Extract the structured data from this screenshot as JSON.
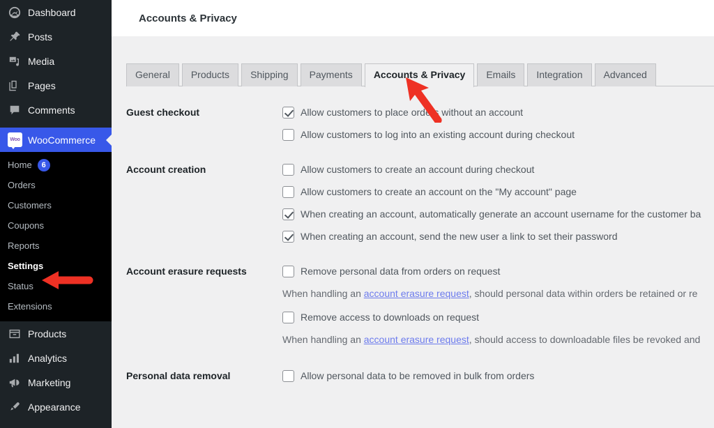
{
  "header": {
    "title": "Accounts & Privacy"
  },
  "sidebar": {
    "top_items": [
      {
        "label": "Dashboard",
        "icon": "dashboard-icon",
        "current": false
      },
      {
        "label": "Posts",
        "icon": "pin-icon",
        "current": false
      },
      {
        "label": "Media",
        "icon": "media-icon",
        "current": false
      },
      {
        "label": "Pages",
        "icon": "pages-icon",
        "current": false
      },
      {
        "label": "Comments",
        "icon": "comments-icon",
        "current": false
      }
    ],
    "woocommerce": {
      "label": "WooCommerce",
      "icon": "woocommerce-icon",
      "current": true
    },
    "submenu": [
      {
        "label": "Home",
        "count": "6",
        "current": false
      },
      {
        "label": "Orders",
        "count": "",
        "current": false
      },
      {
        "label": "Customers",
        "count": "",
        "current": false
      },
      {
        "label": "Coupons",
        "count": "",
        "current": false
      },
      {
        "label": "Reports",
        "count": "",
        "current": false
      },
      {
        "label": "Settings",
        "count": "",
        "current": true
      },
      {
        "label": "Status",
        "count": "",
        "current": false
      },
      {
        "label": "Extensions",
        "count": "",
        "current": false
      }
    ],
    "bottom_items": [
      {
        "label": "Products",
        "icon": "products-icon",
        "current": false
      },
      {
        "label": "Analytics",
        "icon": "analytics-icon",
        "current": false
      },
      {
        "label": "Marketing",
        "icon": "marketing-icon",
        "current": false
      },
      {
        "label": "Appearance",
        "icon": "appearance-icon",
        "current": false
      }
    ]
  },
  "tabs": [
    {
      "label": "General",
      "active": false
    },
    {
      "label": "Products",
      "active": false
    },
    {
      "label": "Shipping",
      "active": false
    },
    {
      "label": "Payments",
      "active": false
    },
    {
      "label": "Accounts & Privacy",
      "active": true
    },
    {
      "label": "Emails",
      "active": false
    },
    {
      "label": "Integration",
      "active": false
    },
    {
      "label": "Advanced",
      "active": false
    }
  ],
  "settings": {
    "guest_checkout": {
      "label": "Guest checkout",
      "options": [
        {
          "label": "Allow customers to place orders without an account",
          "checked": true
        },
        {
          "label": "Allow customers to log into an existing account during checkout",
          "checked": false
        }
      ]
    },
    "account_creation": {
      "label": "Account creation",
      "options": [
        {
          "label": "Allow customers to create an account during checkout",
          "checked": false
        },
        {
          "label": "Allow customers to create an account on the \"My account\" page",
          "checked": false
        },
        {
          "label": "When creating an account, automatically generate an account username for the customer ba",
          "checked": true
        },
        {
          "label": "When creating an account, send the new user a link to set their password",
          "checked": true
        }
      ]
    },
    "account_erasure": {
      "label": "Account erasure requests",
      "option1": {
        "label": "Remove personal data from orders on request",
        "checked": false
      },
      "desc1_before": "When handling an ",
      "desc1_link": "account erasure request",
      "desc1_after": ", should personal data within orders be retained or re",
      "option2": {
        "label": "Remove access to downloads on request",
        "checked": false
      },
      "desc2_before": "When handling an ",
      "desc2_link": "account erasure request",
      "desc2_after": ", should access to downloadable files be revoked and"
    },
    "personal_data_removal": {
      "label": "Personal data removal",
      "options": [
        {
          "label": "Allow personal data to be removed in bulk from orders",
          "checked": false
        }
      ]
    }
  },
  "annotations": {
    "arrow_color": "#ee3124",
    "settings_arrow": "points-left-to-settings",
    "tab_arrow": "points-up-left-to-accounts-privacy-tab"
  },
  "colors": {
    "sidebar_bg": "#1d2327",
    "submenu_bg": "#000000",
    "accent_blue": "#3858e9",
    "page_bg": "#f0f0f1",
    "tab_bg": "#dcdcde",
    "link": "#6c7bed"
  }
}
